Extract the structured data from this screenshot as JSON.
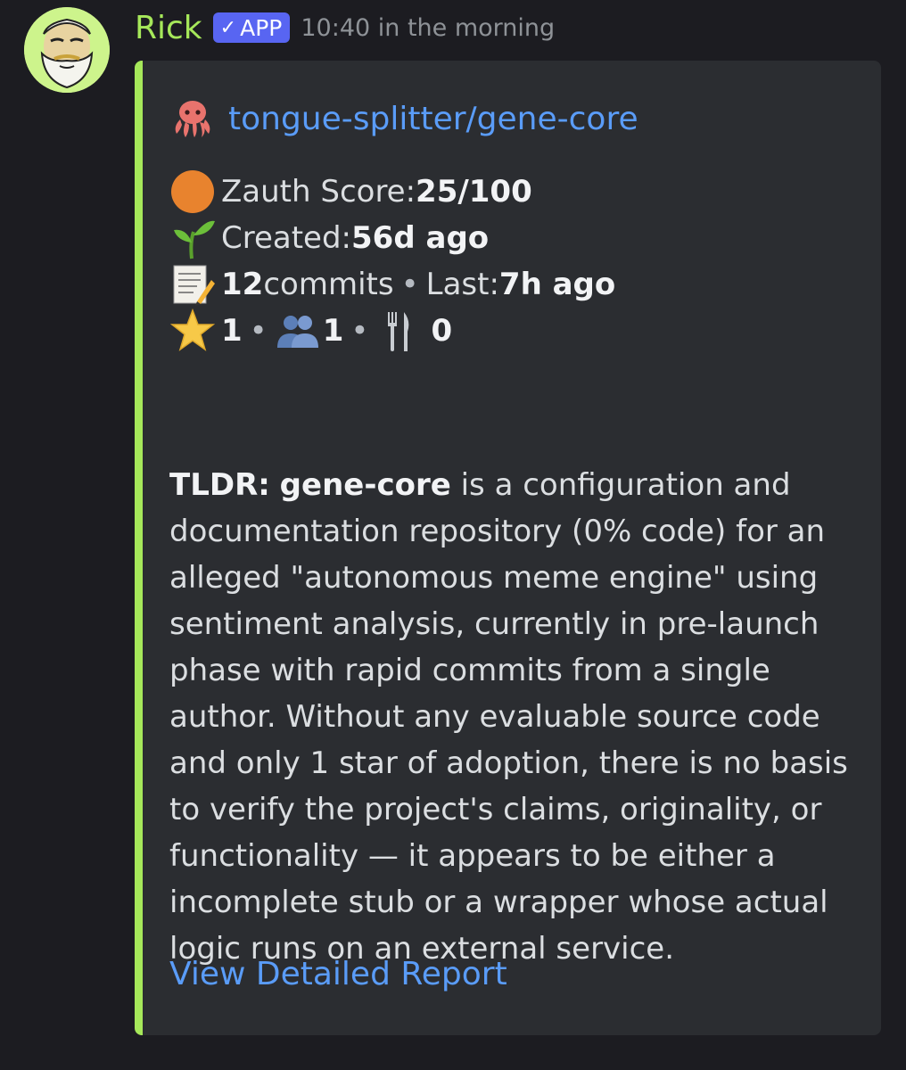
{
  "message": {
    "author": "Rick",
    "badge": "APP",
    "timestamp": "10:40 in the morning"
  },
  "embed": {
    "accent_color": "#a6e85a",
    "title": "tongue-splitter/gene-core",
    "title_icon": "octopus-icon",
    "score": {
      "icon": "orange-circle-icon",
      "label": "Zauth Score: ",
      "value": "25/100"
    },
    "created": {
      "icon": "seedling-icon",
      "label": "Created: ",
      "value": "56d ago"
    },
    "commits": {
      "icon": "memo-icon",
      "count": "12",
      "label": " commits",
      "separator": "•",
      "last_label": "Last: ",
      "last_value": "7h ago"
    },
    "metrics": {
      "stars": "1",
      "contributors": "1",
      "forks": "0",
      "separator": "•"
    },
    "tldr": {
      "label": "TLDR:",
      "subject": "gene-core",
      "text": " is a configuration and documentation repository (0% code) for an alleged \"autonomous meme engine\" using sentiment analysis, currently in pre-launch phase with rapid commits from a single author. Without any evaluable source code and only 1 star of adoption, there is no basis to verify the project's claims, originality, or functionality — it appears to be either a incomplete stub or a wrapper whose actual logic runs on an external service."
    },
    "report_link": "View Detailed Report"
  }
}
